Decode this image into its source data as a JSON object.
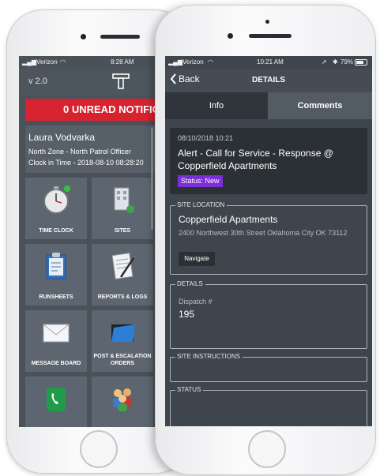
{
  "back_phone": {
    "status": {
      "carrier": "Verizon",
      "time": "8:28 AM"
    },
    "version": "v 2.0",
    "unread_banner": "0 UNREAD NOTIFICA",
    "user": {
      "name": "Laura Vodvarka",
      "zone": "North Zone - North Patrol Officer",
      "clock_in": "Clock in Time - 2018-08-10 08:28:20"
    },
    "tiles": [
      {
        "label": "TIME CLOCK",
        "icon": "stopwatch-icon"
      },
      {
        "label": "SITES",
        "icon": "building-icon"
      },
      {
        "label": "RUNSHEETS",
        "icon": "clipboard-icon"
      },
      {
        "label": "REPORTS & LOGS",
        "icon": "notepad-icon"
      },
      {
        "label": "MESSAGE BOARD",
        "icon": "envelope-icon"
      },
      {
        "label": "POST & ESCALATION ORDERS",
        "icon": "folder-icon"
      },
      {
        "label": "",
        "icon": "phone-icon"
      },
      {
        "label": "",
        "icon": "people-icon"
      }
    ]
  },
  "front_phone": {
    "status": {
      "carrier": "Verizon",
      "time": "10:21 AM",
      "battery": "79%"
    },
    "nav": {
      "back_label": "Back",
      "title": "DETAILS"
    },
    "tabs": [
      {
        "label": "Info"
      },
      {
        "label": "Comments"
      }
    ],
    "alert": {
      "datetime": "08/10/2018 10:21",
      "title": "Alert - Call for Service - Response @ Copperfield Apartments",
      "status": "Status: New"
    },
    "site_location": {
      "legend": "SITE LOCATION",
      "name": "Copperfield Apartments",
      "address": "2400 Northwest 30th Street Oklahoma City OK 73112",
      "navigate_label": "Navigate"
    },
    "details": {
      "legend": "DETAILS",
      "dispatch_label": "Dispatch #",
      "dispatch_value": "195"
    },
    "site_instructions": {
      "legend": "SITE INSTRUCTIONS"
    },
    "status_section": {
      "legend": "STATUS"
    }
  },
  "colors": {
    "unread_red": "#d7232f",
    "status_badge_purple": "#7b2fd6",
    "screen_dark": "#3e454c",
    "tile_bg": "#5d6670"
  }
}
